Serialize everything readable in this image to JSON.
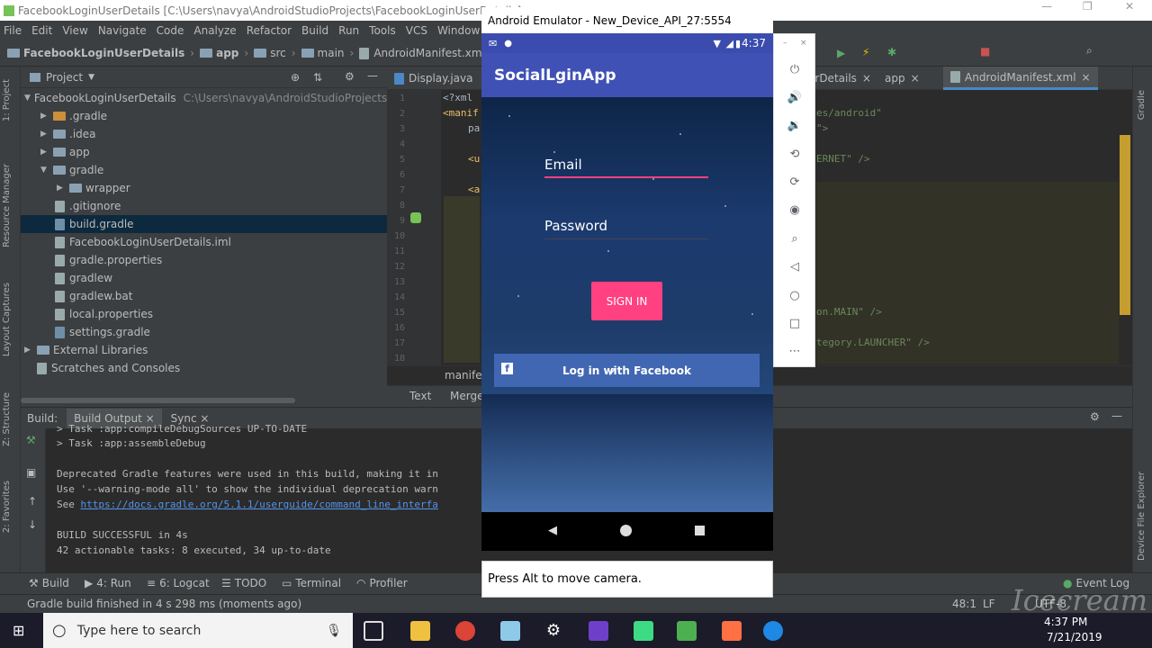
{
  "window": {
    "title": "FacebookLoginUserDetails [C:\\Users\\navya\\AndroidStudioProjects\\FacebookLoginUserDetails] - ..."
  },
  "menu": [
    "File",
    "Edit",
    "View",
    "Navigate",
    "Code",
    "Analyze",
    "Refactor",
    "Build",
    "Run",
    "Tools",
    "VCS",
    "Window",
    "He"
  ],
  "breadcrumb": [
    "FacebookLoginUserDetails",
    "app",
    "src",
    "main",
    "AndroidManifest.xml"
  ],
  "left_tool_tabs": [
    "1: Project",
    "Resource Manager",
    "Layout Captures",
    "Z: Structure",
    "2: Favorites"
  ],
  "right_tool_tabs": [
    "Gradle",
    "Device File Explorer"
  ],
  "project_panel": {
    "header": "Project",
    "items": [
      {
        "label": "FacebookLoginUserDetails",
        "path": "C:\\Users\\navya\\AndroidStudioProjects\\Fa",
        "depth": 0,
        "expanded": true
      },
      {
        "label": ".gradle",
        "depth": 1,
        "expanded": false
      },
      {
        "label": ".idea",
        "depth": 1,
        "expanded": false
      },
      {
        "label": "app",
        "depth": 1,
        "expanded": false
      },
      {
        "label": "gradle",
        "depth": 1,
        "expanded": true
      },
      {
        "label": "wrapper",
        "depth": 2,
        "expanded": false
      },
      {
        "label": ".gitignore",
        "depth": 1
      },
      {
        "label": "build.gradle",
        "depth": 1,
        "selected": true
      },
      {
        "label": "FacebookLoginUserDetails.iml",
        "depth": 1
      },
      {
        "label": "gradle.properties",
        "depth": 1
      },
      {
        "label": "gradlew",
        "depth": 1
      },
      {
        "label": "gradlew.bat",
        "depth": 1
      },
      {
        "label": "local.properties",
        "depth": 1
      },
      {
        "label": "settings.gradle",
        "depth": 1
      },
      {
        "label": "External Libraries",
        "depth": 0,
        "expanded": false
      },
      {
        "label": "Scratches and Consoles",
        "depth": 0
      }
    ]
  },
  "editor": {
    "tabs": [
      "Display.java",
      "erDetails",
      "app",
      "AndroidManifest.xml"
    ],
    "line_numbers": [
      "1",
      "2",
      "3",
      "4",
      "5",
      "6",
      "7",
      "8",
      "9",
      "10",
      "11",
      "12",
      "13",
      "14",
      "15",
      "16",
      "17",
      "18"
    ],
    "code_left": [
      "<?xml",
      "<manif",
      "pa",
      "",
      "<u",
      "",
      "<a"
    ],
    "code_right": [
      "es/android\"",
      "\">",
      "",
      "ERNET\" />",
      "",
      "",
      "",
      "",
      "",
      "",
      "",
      "",
      "on.MAIN\" />",
      "",
      "tegory.LAUNCHER\" />"
    ],
    "footer_file": "manifes",
    "bottom_tabs": [
      "Text",
      "Merge"
    ]
  },
  "build": {
    "tabs": [
      "Build:",
      "Build Output",
      "Sync"
    ],
    "lines": [
      "> Task :app:compileDebugSources UP-TO-DATE",
      "> Task :app:assembleDebug",
      "",
      "Deprecated Gradle features were used in this build, making it in",
      "Use '--warning-mode all' to show the individual deprecation warn",
      "See https://docs.gradle.org/5.1.1/userguide/command_line_interfa",
      "",
      "BUILD SUCCESSFUL in 4s",
      "42 actionable tasks: 8 executed, 34 up-to-date"
    ],
    "link_prefix": "See ",
    "link_text": "https://docs.gradle.org/5.1.1/userguide/command_line_interfa"
  },
  "tool_windows": [
    "Build",
    "4: Run",
    "6: Logcat",
    "TODO",
    "Terminal",
    "Profiler"
  ],
  "event_log": "Event Log",
  "status": {
    "message": "Gradle build finished in 4 s 298 ms (moments ago)",
    "position": "48:1",
    "encoding": "LF",
    "extra": "UTF-8"
  },
  "emulator": {
    "title": "Android Emulator - New_Device_API_27:5554",
    "clock": "4:37",
    "app_title": "SocialLginApp",
    "email_hint": "Email",
    "password_hint": "Password",
    "sign_in": "SIGN IN",
    "fb_button": "Log in with Facebook",
    "hint": "Press Alt to move camera.",
    "accent": "#ff4081",
    "primary": "#3f51b5",
    "facebook": "#4267b2"
  },
  "taskbar": {
    "search_placeholder": "Type here to search",
    "time": "4:37 PM",
    "date": "7/21/2019"
  },
  "watermark": "Icecream"
}
